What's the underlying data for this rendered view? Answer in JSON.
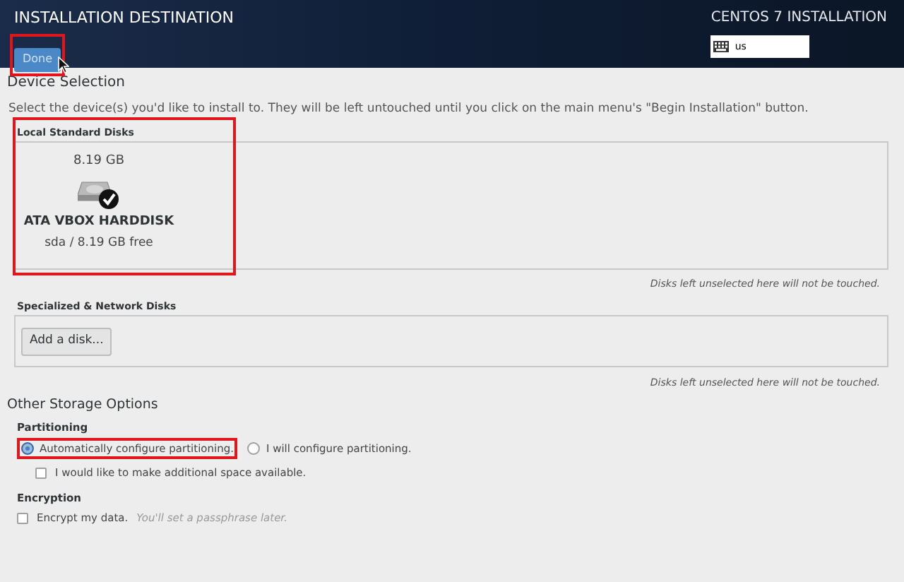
{
  "header": {
    "title": "INSTALLATION DESTINATION",
    "done_button": "Done",
    "done_highlighted": true,
    "product": "CENTOS 7 INSTALLATION",
    "keyboard_layout": "us"
  },
  "device_selection": {
    "heading": "Device Selection",
    "description": "Select the device(s) you'd like to install to.  They will be left untouched until you click on the main menu's \"Begin Installation\" button.",
    "local_disks": {
      "label": "Local Standard Disks",
      "highlighted": true,
      "disks": [
        {
          "size": "8.19 GB",
          "name": "ATA VBOX HARDDISK",
          "device_info": "sda  /  8.19 GB free",
          "selected": true
        }
      ],
      "hint": "Disks left unselected here will not be touched."
    },
    "network_disks": {
      "label": "Specialized & Network Disks",
      "add_button": "Add a disk...",
      "hint": "Disks left unselected here will not be touched."
    }
  },
  "other_storage": {
    "heading": "Other Storage Options",
    "partitioning": {
      "label": "Partitioning",
      "options": [
        {
          "label": "Automatically configure partitioning.",
          "selected": true,
          "highlighted": true
        },
        {
          "label": "I will configure partitioning.",
          "selected": false,
          "highlighted": false
        }
      ],
      "reclaim": {
        "label": "I would like to make additional space available.",
        "checked": false
      }
    },
    "encryption": {
      "label": "Encryption",
      "encrypt": {
        "label": "Encrypt my data.",
        "hint": "You'll set a passphrase later.",
        "checked": false
      }
    }
  }
}
